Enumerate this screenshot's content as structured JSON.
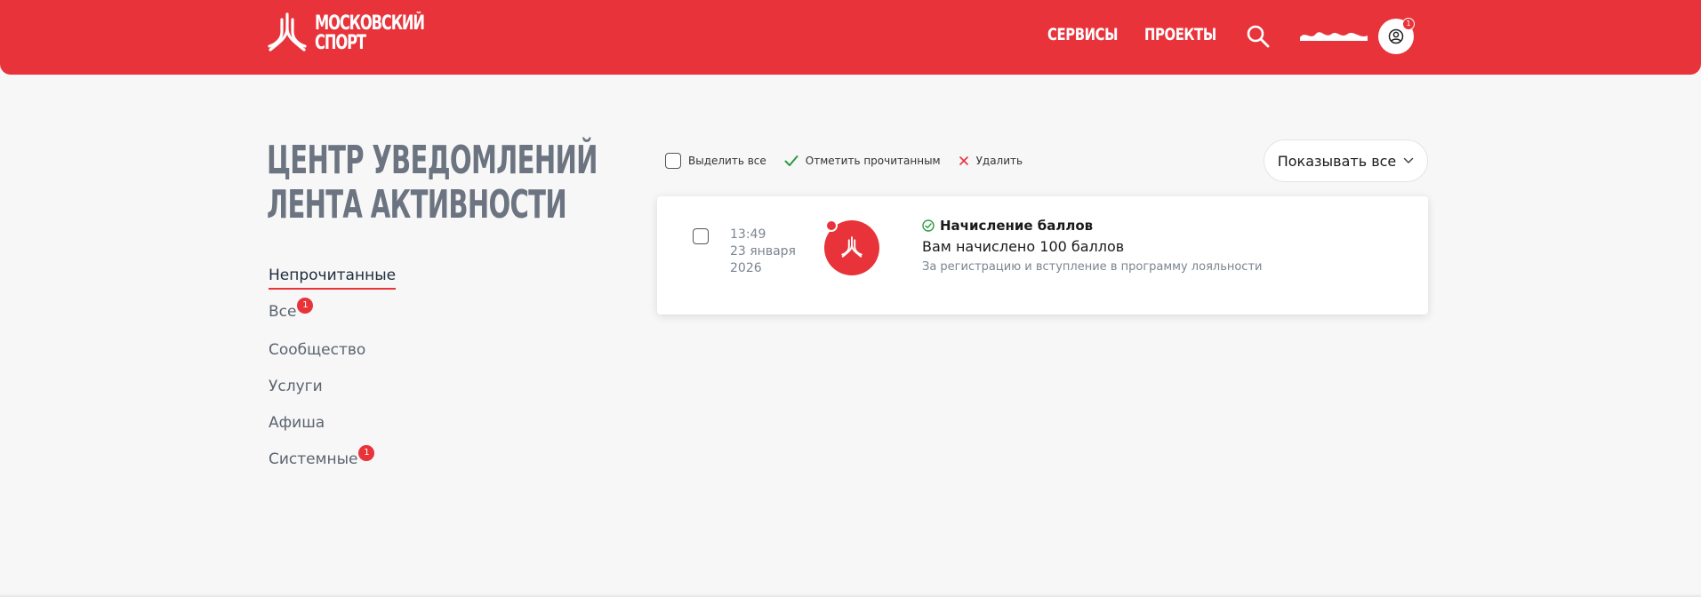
{
  "header": {
    "logo": {
      "line1": "МОСКОВСКИЙ",
      "line2": "СПОРТ"
    },
    "nav": {
      "services": "СЕРВИСЫ",
      "projects": "ПРОЕКТЫ"
    },
    "avatar_badge": "1",
    "brand_color": "#e8333a"
  },
  "page": {
    "title_line1": "ЦЕНТР УВЕДОМЛЕНИЙ",
    "title_line2": "ЛЕНТА АКТИВНОСТИ"
  },
  "sidebar": {
    "items": [
      {
        "label": "Непрочитанные",
        "active": true,
        "badge": ""
      },
      {
        "label": "Все",
        "active": false,
        "badge": "1"
      },
      {
        "label": "Сообщество",
        "active": false,
        "badge": ""
      },
      {
        "label": "Услуги",
        "active": false,
        "badge": ""
      },
      {
        "label": "Афиша",
        "active": false,
        "badge": ""
      },
      {
        "label": "Системные",
        "active": false,
        "badge": "1"
      }
    ]
  },
  "toolbar": {
    "select_all": "Выделить все",
    "mark_read": "Отметить прочитанным",
    "delete": "Удалить",
    "filter": "Показывать все"
  },
  "notifications": [
    {
      "time": "13:49",
      "date_line1": "23 января",
      "date_line2": "2026",
      "title": "Начисление баллов",
      "text": "Вам начислено 100 баллов",
      "subtext": "За регистрацию и вступление в программу лояльности",
      "unread": true
    }
  ],
  "icons": {
    "logo": "mos-sport-logo-icon",
    "search": "search-icon",
    "avatar": "user-circle-icon",
    "check": "check-icon",
    "delete": "cross-icon",
    "chevron": "chevron-down-icon",
    "status": "check-circle-icon"
  }
}
